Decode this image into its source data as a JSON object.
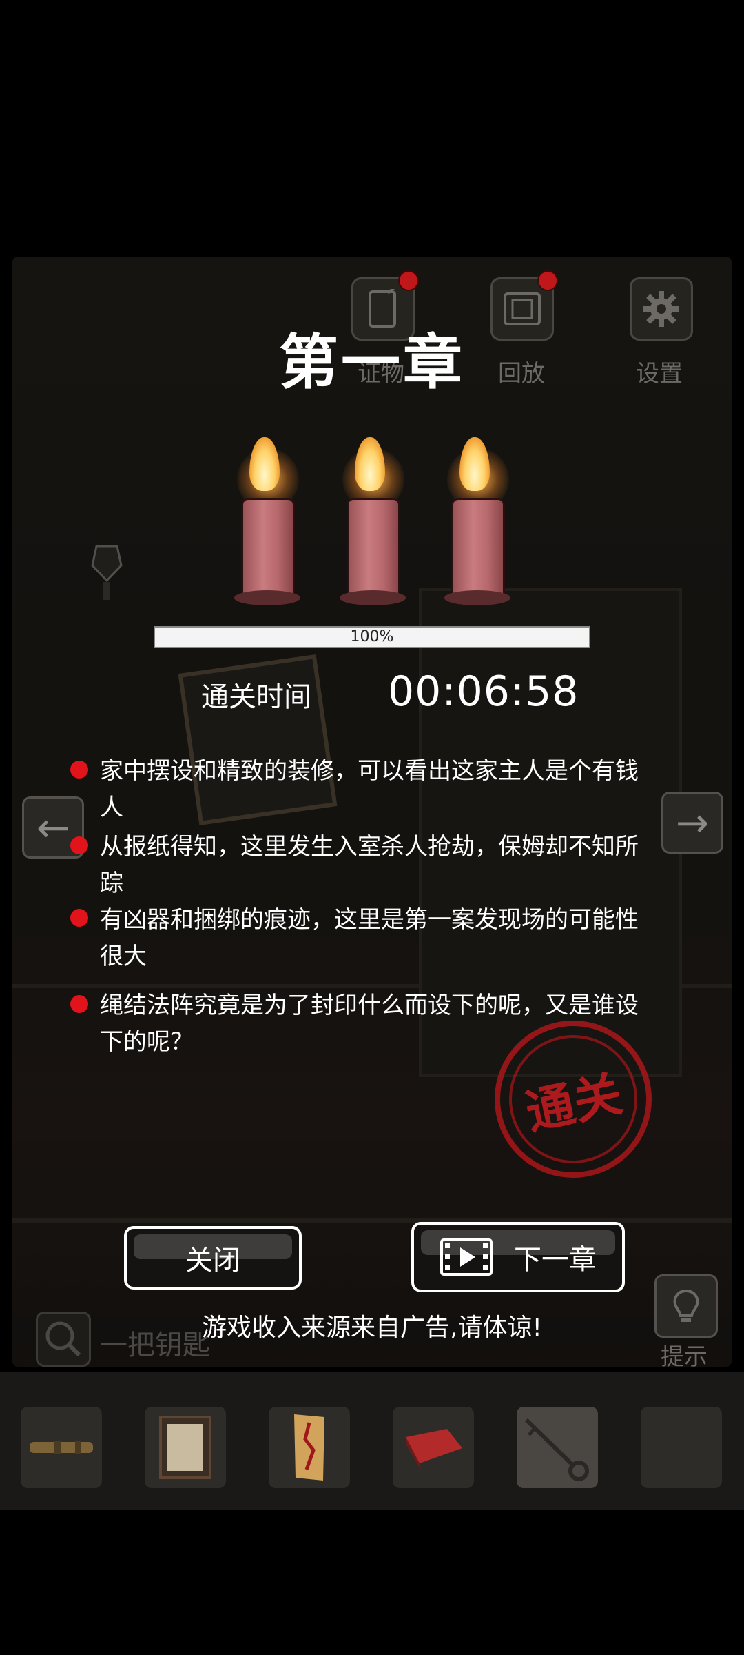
{
  "toolbar": {
    "evidence_label": "证物",
    "replay_label": "回放",
    "settings_label": "设置"
  },
  "dialog": {
    "chapter_title": "第一章",
    "progress_text": "100%",
    "progress_value": 100,
    "time_label": "通关时间",
    "time_value": "00:06:58",
    "clues": [
      "家中摆设和精致的装修，可以看出这家主人是个有钱人",
      "从报纸得知，这里发生入室杀人抢劫，保姆却不知所踪",
      "有凶器和捆绑的痕迹，这里是第一案发现场的可能性很大",
      "绳结法阵究竟是为了封印什么而设下的呢，又是谁设下的呢？"
    ],
    "stamp_text": "通关",
    "close_label": "关闭",
    "next_label": "下一章",
    "ad_note": "游戏收入来源来自广告,请体谅!"
  },
  "scene": {
    "search_text": "一把钥匙",
    "hint_label": "提示"
  },
  "inventory": {
    "items": [
      "telescope-icon",
      "framed-paper-icon",
      "talisman-icon",
      "matchbox-icon",
      "key-icon",
      "empty-slot"
    ]
  },
  "colors": {
    "accent_red": "#e1141c",
    "stamp_red": "#aa161a"
  }
}
